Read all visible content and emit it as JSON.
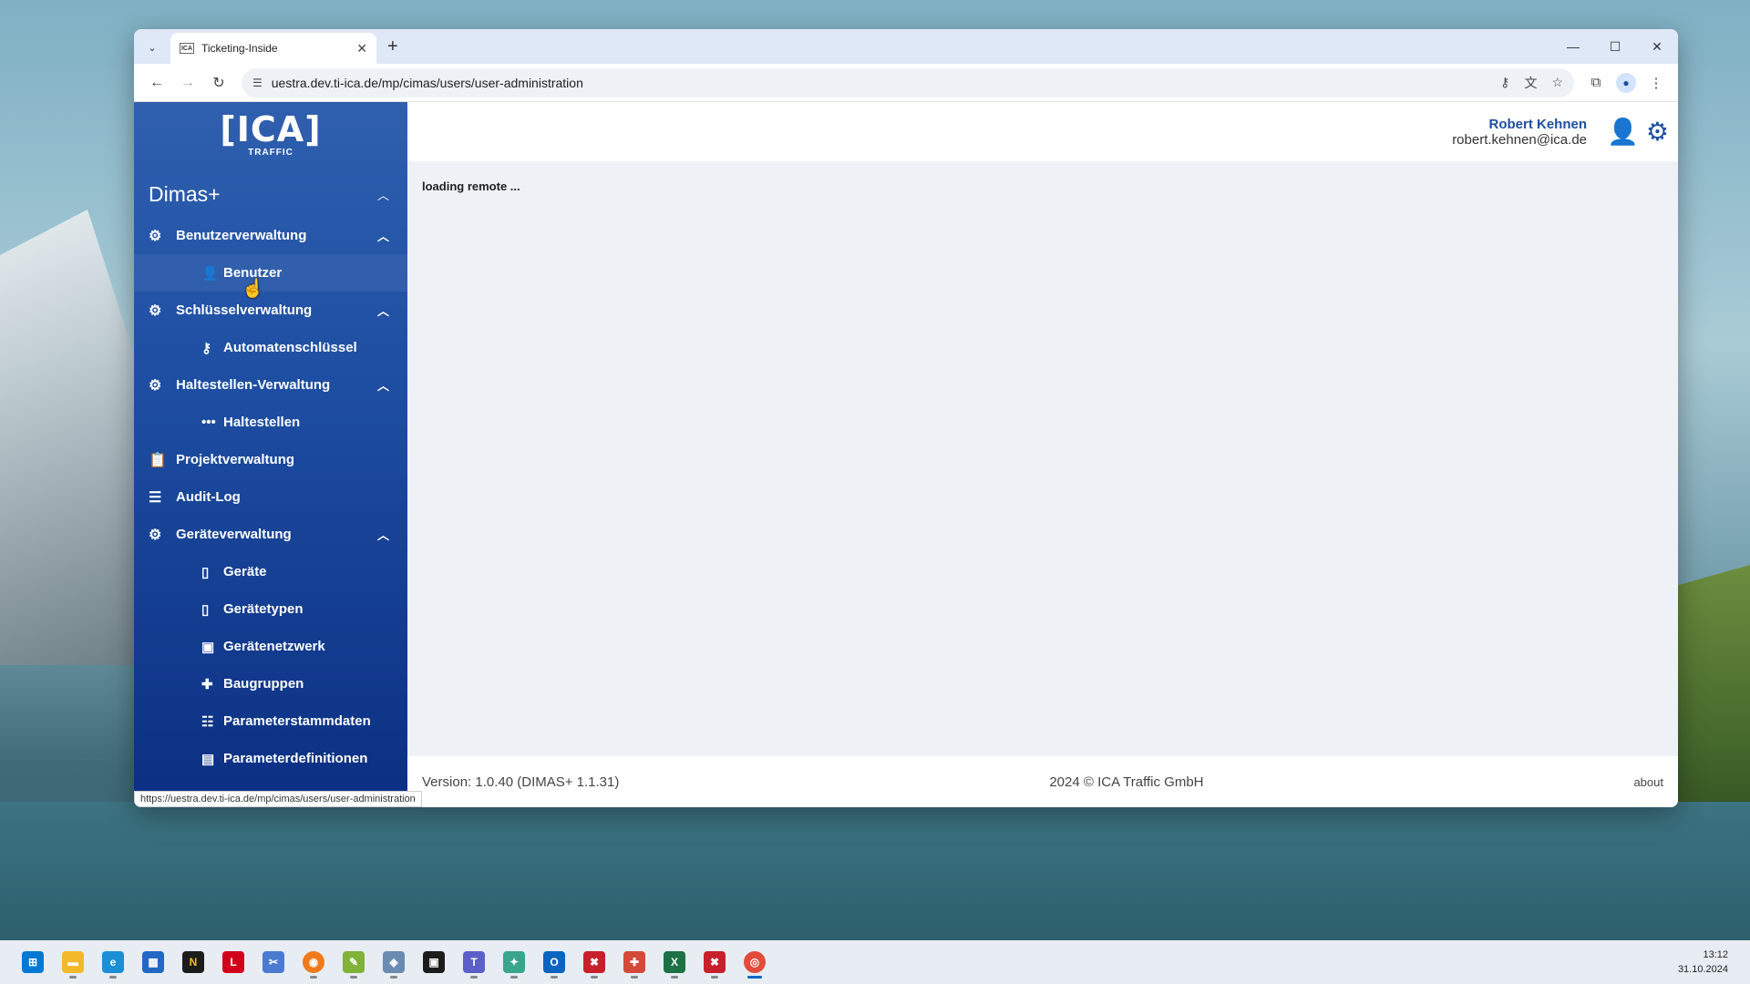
{
  "browser": {
    "tab_title": "Ticketing-Inside",
    "favicon_text": "ICA",
    "url": "uestra.dev.ti-ica.de/mp/cimas/users/user-administration",
    "status_url": "https://uestra.dev.ti-ica.de/mp/cimas/users/user-administration"
  },
  "logo": {
    "mark": "[ICA]",
    "sub": "TRAFFIC"
  },
  "sidebar": {
    "app_title": "Dimas+",
    "groups": [
      {
        "label": "Benutzerverwaltung",
        "icon": "user-gear-icon",
        "items": [
          {
            "label": "Benutzer",
            "icon": "user-icon"
          }
        ]
      },
      {
        "label": "Schlüsselverwaltung",
        "icon": "key-gear-icon",
        "items": [
          {
            "label": "Automatenschlüssel",
            "icon": "key-icon"
          }
        ]
      },
      {
        "label": "Haltestellen-Verwaltung",
        "icon": "stops-gear-icon",
        "items": [
          {
            "label": "Haltestellen",
            "icon": "stops-icon"
          }
        ]
      },
      {
        "label": "Projektverwaltung",
        "icon": "clipboard-icon"
      },
      {
        "label": "Audit-Log",
        "icon": "list-icon"
      },
      {
        "label": "Geräteverwaltung",
        "icon": "device-gear-icon",
        "items": [
          {
            "label": "Geräte",
            "icon": "device-icon"
          },
          {
            "label": "Gerätetypen",
            "icon": "device-types-icon"
          },
          {
            "label": "Gerätenetzwerk",
            "icon": "network-icon"
          },
          {
            "label": "Baugruppen",
            "icon": "puzzle-icon"
          },
          {
            "label": "Parameterstammdaten",
            "icon": "table-list-icon"
          },
          {
            "label": "Parameterdefinitionen",
            "icon": "clipboard-list-icon"
          }
        ]
      }
    ]
  },
  "header": {
    "user_name": "Robert Kehnen",
    "user_email": "robert.kehnen@ica.de"
  },
  "main": {
    "loading_text": "loading remote ..."
  },
  "footer": {
    "version": "Version: 1.0.40 (DIMAS+ 1.1.31)",
    "copyright": "2024 © ICA Traffic GmbH",
    "about": "about"
  },
  "taskbar": {
    "time": "13:12",
    "date": "31.10.2024"
  },
  "colors": {
    "sidebar_top": "#2f5fae",
    "sidebar_bottom": "#0b2f82",
    "accent": "#1e4ea2"
  }
}
